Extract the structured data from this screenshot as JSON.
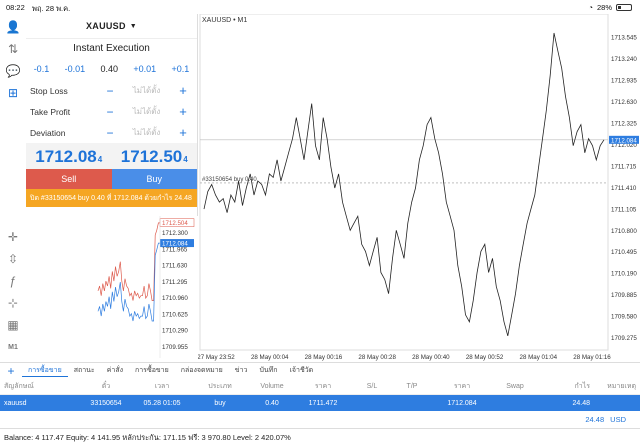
{
  "status": {
    "time": "08:22",
    "date": "พฤ. 28 พ.ค.",
    "battery": "28%",
    "battery_level": 0.28
  },
  "order": {
    "symbol": "XAUUSD",
    "execution": "Instant Execution",
    "volume_steps": [
      "-0.1",
      "-0.01",
      "0.40",
      "+0.01",
      "+0.1"
    ],
    "fields": [
      {
        "label": "Stop Loss",
        "value": "ไม่ได้ตั้ง"
      },
      {
        "label": "Take Profit",
        "value": "ไม่ได้ตั้ง"
      },
      {
        "label": "Deviation",
        "value": "ไม่ได้ตั้ง"
      }
    ],
    "bid_main": "1712.08",
    "bid_sup": "4",
    "ask_main": "1712.50",
    "ask_sup": "4",
    "sell_label": "Sell",
    "buy_label": "Buy",
    "close_text": "ปิด #33150654 buy 0.40 ที่ 1712.084 ด้วยกำไร 24.48"
  },
  "left_chart": {
    "price_labels": [
      "1712.504",
      "1712.084",
      "1712.300",
      "1711.965",
      "1711.630",
      "1711.295",
      "1710.960",
      "1710.625",
      "1710.290",
      "1709.955"
    ],
    "ask_color": "#dd5a4c",
    "bid_color": "#2e7de0"
  },
  "chart_data": {
    "type": "line",
    "title": "XAUUSD • M1",
    "x_labels": [
      "27 May 23:52",
      "28 May 00:04",
      "28 May 00:16",
      "28 May 00:28",
      "28 May 00:40",
      "28 May 00:52",
      "28 May 01:04",
      "28 May 01:16"
    ],
    "y_labels": [
      "1713.545",
      "1713.240",
      "1712.935",
      "1712.630",
      "1712.325",
      "1712.020",
      "1711.715",
      "1711.410",
      "1711.105",
      "1710.800",
      "1710.495",
      "1710.190",
      "1709.885",
      "1709.580",
      "1709.275"
    ],
    "ylim": [
      1709.1,
      1713.7
    ],
    "current_price": "1712.084",
    "position_label": "#33150654 buy 0.40",
    "position_price": 1711.472,
    "series": [
      {
        "values": [
          1711.1,
          1711.35,
          1711.45,
          1711.3,
          1711.2,
          1711.25,
          1711.05,
          1711.3,
          1711.2,
          1711.5,
          1711.15,
          1711.4,
          1711.6,
          1711.3,
          1711.5,
          1711.45,
          1711.3,
          1711.6,
          1711.55,
          1711.8,
          1711.5,
          1711.7,
          1711.9,
          1712.1,
          1712.4,
          1712.1,
          1711.8,
          1712.2,
          1712.6,
          1712.0,
          1711.8,
          1712.4,
          1712.1,
          1711.7,
          1711.4,
          1711.6,
          1711.2,
          1711.0,
          1710.8,
          1710.9,
          1711.0,
          1710.6,
          1710.5,
          1710.3,
          1710.5,
          1710.7,
          1710.2,
          1710.1,
          1709.9,
          1710.4,
          1710.8,
          1710.6,
          1710.4,
          1710.9,
          1711.2,
          1711.4,
          1711.8,
          1712.0,
          1712.3,
          1712.4,
          1712.1,
          1711.9,
          1711.6,
          1711.2,
          1711.0,
          1710.8,
          1710.3,
          1710.0,
          1709.6,
          1709.5,
          1709.8,
          1710.2,
          1710.5,
          1710.6,
          1710.2,
          1710.4,
          1710.0,
          1709.8,
          1709.5,
          1709.3,
          1709.6,
          1709.9,
          1710.3,
          1710.6,
          1710.9,
          1711.1,
          1711.3,
          1711.7,
          1712.1,
          1712.5,
          1713.0,
          1713.6,
          1713.35,
          1713.1,
          1712.7,
          1712.4,
          1712.0,
          1712.2,
          1712.3,
          1711.9,
          1712.1,
          1712.0,
          1711.8,
          1712.0,
          1712.084
        ]
      }
    ]
  },
  "tabs": [
    "การซื้อขาย",
    "สถานะ",
    "ค่าสั่ง",
    "การซื้อขาย",
    "กล่องจดหมาย",
    "ข่าว",
    "บันทึก",
    "เจ้าชีวัด"
  ],
  "table": {
    "headers": [
      "สัญลักษณ์",
      "ตั๋ว",
      "เวลา",
      "ประเภท",
      "Volume",
      "ราคา",
      "S/L",
      "T/P",
      "ราคา",
      "Swap",
      "กำไร",
      "หมายเหตุ"
    ],
    "row": [
      "xauusd",
      "33150654",
      "05.28 01:05",
      "buy",
      "0.40",
      "1711.472",
      "",
      "",
      "1712.084",
      "",
      "24.48",
      ""
    ],
    "total_profit": "24.48",
    "currency": "USD"
  },
  "balance_text": "Balance: 4 117.47 Equity: 4 141.95 หลักประกัน: 171.15 ฟรี: 3 970.80 Level: 2 420.07%"
}
